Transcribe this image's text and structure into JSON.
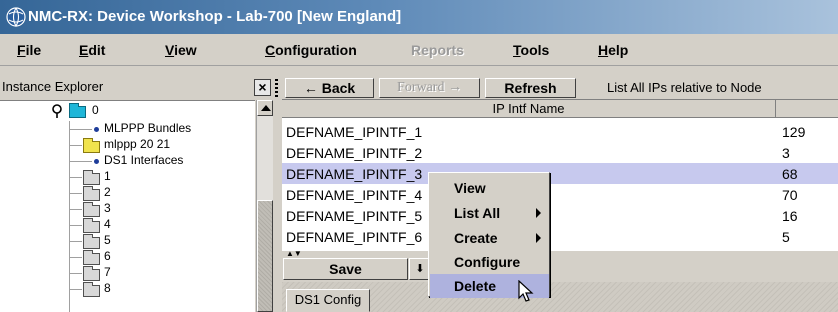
{
  "window": {
    "title": "NMC-RX: Device Workshop - Lab-700 [New England]",
    "icon": "nmc-globe-icon",
    "title_gradient": [
      "#356697",
      "#a9c2dc"
    ]
  },
  "menubar": {
    "items": [
      {
        "mnemonic": "F",
        "rest": "ile",
        "disabled": false
      },
      {
        "mnemonic": "E",
        "rest": "dit",
        "disabled": false
      },
      {
        "mnemonic": "V",
        "rest": "iew",
        "disabled": false
      },
      {
        "mnemonic": "C",
        "rest": "onfiguration",
        "disabled": false
      },
      {
        "mnemonic": "",
        "rest": "Reports",
        "disabled": true
      },
      {
        "mnemonic": "T",
        "rest": "ools",
        "disabled": false
      },
      {
        "mnemonic": "H",
        "rest": "elp",
        "disabled": false
      }
    ]
  },
  "explorer": {
    "title": "Instance Explorer",
    "close_label": "×",
    "tree": {
      "root": {
        "label": "0",
        "icon": "cyan-folder-icon",
        "expander": "pin-icon"
      },
      "children": [
        {
          "label": "MLPPP Bundles",
          "icon": "bullet-icon"
        },
        {
          "label": "mlppp 20 21",
          "icon": "yellow-folder-icon"
        },
        {
          "label": "DS1 Interfaces",
          "icon": "bullet-icon"
        },
        {
          "label": "1",
          "icon": "folder-icon"
        },
        {
          "label": "2",
          "icon": "folder-icon"
        },
        {
          "label": "3",
          "icon": "folder-icon"
        },
        {
          "label": "4",
          "icon": "folder-icon"
        },
        {
          "label": "5",
          "icon": "folder-icon"
        },
        {
          "label": "6",
          "icon": "folder-icon"
        },
        {
          "label": "7",
          "icon": "folder-icon"
        },
        {
          "label": "8",
          "icon": "folder-icon"
        }
      ]
    }
  },
  "nav": {
    "back_label": "← Back",
    "forward_label": "Forward →",
    "refresh_label": "Refresh",
    "status_text": "List All IPs relative to Node"
  },
  "table": {
    "header": "IP Intf Name",
    "rows": [
      {
        "name": "DEFNAME_IPINTF_1",
        "value": "129",
        "selected": false
      },
      {
        "name": "DEFNAME_IPINTF_2",
        "value": "3",
        "selected": false
      },
      {
        "name": "DEFNAME_IPINTF_3",
        "value": "68",
        "selected": true
      },
      {
        "name": "DEFNAME_IPINTF_4",
        "value": "70",
        "selected": false
      },
      {
        "name": "DEFNAME_IPINTF_5",
        "value": "16",
        "selected": false
      },
      {
        "name": "DEFNAME_IPINTF_6",
        "value": "5",
        "selected": false
      }
    ],
    "selected_color": "#c7c9ee"
  },
  "bottom": {
    "save_label": "Save",
    "save_arrow": "⬇",
    "tab_label": "DS1 Config"
  },
  "context_menu": {
    "items": [
      {
        "label": "View",
        "submenu": false,
        "active": false
      },
      {
        "label": "List All",
        "submenu": true,
        "active": false
      },
      {
        "label": "Create",
        "submenu": true,
        "active": false
      },
      {
        "label": "Configure",
        "submenu": false,
        "active": false
      },
      {
        "label": "Delete",
        "submenu": false,
        "active": true
      }
    ],
    "highlight_color": "#aeb2de"
  }
}
